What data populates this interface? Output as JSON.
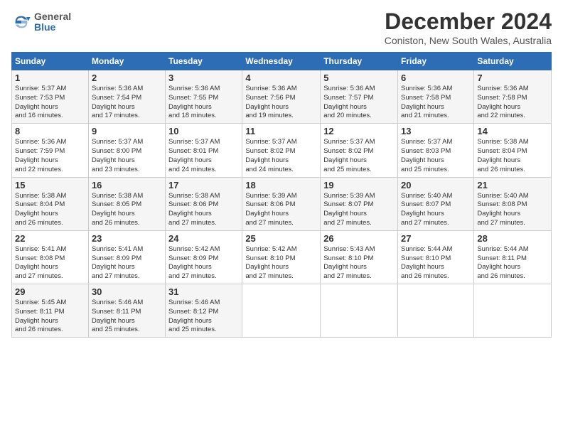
{
  "header": {
    "logo_general": "General",
    "logo_blue": "Blue",
    "title": "December 2024",
    "location": "Coniston, New South Wales, Australia"
  },
  "weekdays": [
    "Sunday",
    "Monday",
    "Tuesday",
    "Wednesday",
    "Thursday",
    "Friday",
    "Saturday"
  ],
  "weeks": [
    [
      {
        "day": "1",
        "sunrise": "5:37 AM",
        "sunset": "7:53 PM",
        "daylight": "14 hours and 16 minutes."
      },
      {
        "day": "2",
        "sunrise": "5:36 AM",
        "sunset": "7:54 PM",
        "daylight": "14 hours and 17 minutes."
      },
      {
        "day": "3",
        "sunrise": "5:36 AM",
        "sunset": "7:55 PM",
        "daylight": "14 hours and 18 minutes."
      },
      {
        "day": "4",
        "sunrise": "5:36 AM",
        "sunset": "7:56 PM",
        "daylight": "14 hours and 19 minutes."
      },
      {
        "day": "5",
        "sunrise": "5:36 AM",
        "sunset": "7:57 PM",
        "daylight": "14 hours and 20 minutes."
      },
      {
        "day": "6",
        "sunrise": "5:36 AM",
        "sunset": "7:58 PM",
        "daylight": "14 hours and 21 minutes."
      },
      {
        "day": "7",
        "sunrise": "5:36 AM",
        "sunset": "7:58 PM",
        "daylight": "14 hours and 22 minutes."
      }
    ],
    [
      {
        "day": "8",
        "sunrise": "5:36 AM",
        "sunset": "7:59 PM",
        "daylight": "14 hours and 22 minutes."
      },
      {
        "day": "9",
        "sunrise": "5:37 AM",
        "sunset": "8:00 PM",
        "daylight": "14 hours and 23 minutes."
      },
      {
        "day": "10",
        "sunrise": "5:37 AM",
        "sunset": "8:01 PM",
        "daylight": "14 hours and 24 minutes."
      },
      {
        "day": "11",
        "sunrise": "5:37 AM",
        "sunset": "8:02 PM",
        "daylight": "14 hours and 24 minutes."
      },
      {
        "day": "12",
        "sunrise": "5:37 AM",
        "sunset": "8:02 PM",
        "daylight": "14 hours and 25 minutes."
      },
      {
        "day": "13",
        "sunrise": "5:37 AM",
        "sunset": "8:03 PM",
        "daylight": "14 hours and 25 minutes."
      },
      {
        "day": "14",
        "sunrise": "5:38 AM",
        "sunset": "8:04 PM",
        "daylight": "14 hours and 26 minutes."
      }
    ],
    [
      {
        "day": "15",
        "sunrise": "5:38 AM",
        "sunset": "8:04 PM",
        "daylight": "14 hours and 26 minutes."
      },
      {
        "day": "16",
        "sunrise": "5:38 AM",
        "sunset": "8:05 PM",
        "daylight": "14 hours and 26 minutes."
      },
      {
        "day": "17",
        "sunrise": "5:38 AM",
        "sunset": "8:06 PM",
        "daylight": "14 hours and 27 minutes."
      },
      {
        "day": "18",
        "sunrise": "5:39 AM",
        "sunset": "8:06 PM",
        "daylight": "14 hours and 27 minutes."
      },
      {
        "day": "19",
        "sunrise": "5:39 AM",
        "sunset": "8:07 PM",
        "daylight": "14 hours and 27 minutes."
      },
      {
        "day": "20",
        "sunrise": "5:40 AM",
        "sunset": "8:07 PM",
        "daylight": "14 hours and 27 minutes."
      },
      {
        "day": "21",
        "sunrise": "5:40 AM",
        "sunset": "8:08 PM",
        "daylight": "14 hours and 27 minutes."
      }
    ],
    [
      {
        "day": "22",
        "sunrise": "5:41 AM",
        "sunset": "8:08 PM",
        "daylight": "14 hours and 27 minutes."
      },
      {
        "day": "23",
        "sunrise": "5:41 AM",
        "sunset": "8:09 PM",
        "daylight": "14 hours and 27 minutes."
      },
      {
        "day": "24",
        "sunrise": "5:42 AM",
        "sunset": "8:09 PM",
        "daylight": "14 hours and 27 minutes."
      },
      {
        "day": "25",
        "sunrise": "5:42 AM",
        "sunset": "8:10 PM",
        "daylight": "14 hours and 27 minutes."
      },
      {
        "day": "26",
        "sunrise": "5:43 AM",
        "sunset": "8:10 PM",
        "daylight": "14 hours and 27 minutes."
      },
      {
        "day": "27",
        "sunrise": "5:44 AM",
        "sunset": "8:10 PM",
        "daylight": "14 hours and 26 minutes."
      },
      {
        "day": "28",
        "sunrise": "5:44 AM",
        "sunset": "8:11 PM",
        "daylight": "14 hours and 26 minutes."
      }
    ],
    [
      {
        "day": "29",
        "sunrise": "5:45 AM",
        "sunset": "8:11 PM",
        "daylight": "14 hours and 26 minutes."
      },
      {
        "day": "30",
        "sunrise": "5:46 AM",
        "sunset": "8:11 PM",
        "daylight": "14 hours and 25 minutes."
      },
      {
        "day": "31",
        "sunrise": "5:46 AM",
        "sunset": "8:12 PM",
        "daylight": "14 hours and 25 minutes."
      },
      null,
      null,
      null,
      null
    ]
  ]
}
